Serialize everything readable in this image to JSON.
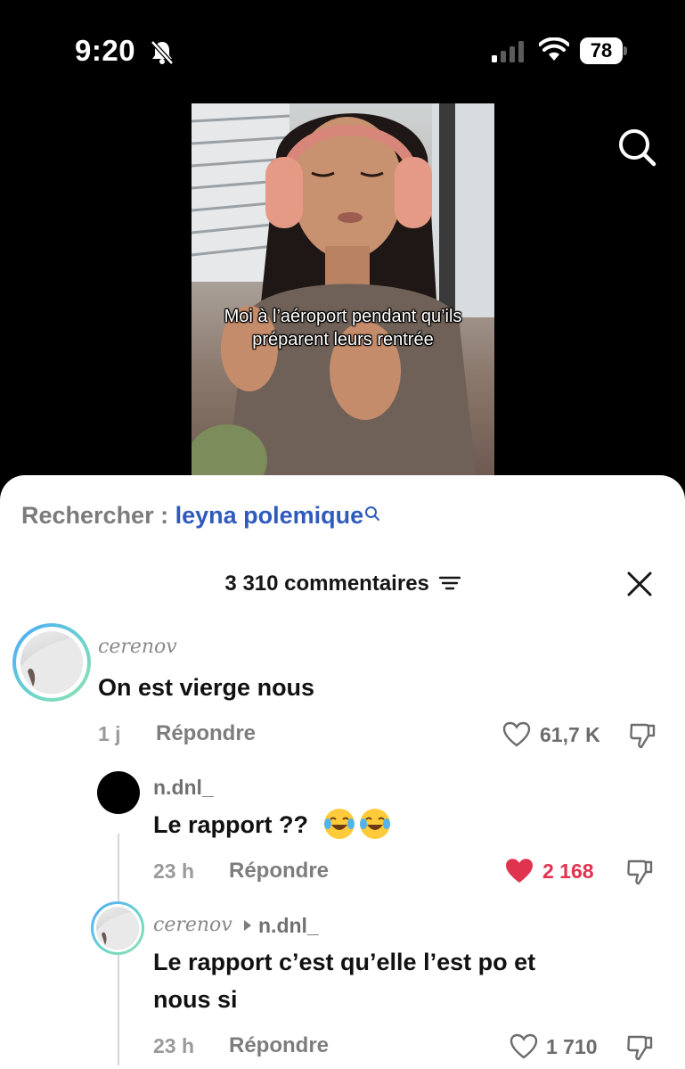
{
  "status_bar": {
    "time": "9:20",
    "battery": "78",
    "icons": [
      "bell-slash-icon",
      "cellular-signal-icon",
      "wifi-icon",
      "battery-icon"
    ]
  },
  "video": {
    "caption_line1": "Moi à l’aéroport pendant qu’ils",
    "caption_line2": "préparent leurs rentrée",
    "search_icon": "search-icon"
  },
  "search_suggestion": {
    "prefix": "Rechercher : ",
    "term": "leyna polemique",
    "icon": "search-icon"
  },
  "comments_header": {
    "count_label": "3 310 commentaires",
    "filter_icon": "filter-icon",
    "close_icon": "close-icon"
  },
  "comments": [
    {
      "username": "cerenov",
      "text": "On est vierge nous",
      "time": "1 j",
      "reply_label": "Répondre",
      "likes": "61,7 K",
      "liked": false
    },
    {
      "username": "n.dnl_",
      "text": "Le rapport ??",
      "emojis": [
        "face-with-tears-of-joy",
        "face-with-tears-of-joy"
      ],
      "time": "23 h",
      "reply_label": "Répondre",
      "likes": "2 168",
      "liked": true
    },
    {
      "username": "cerenov",
      "reply_to": "n.dnl_",
      "text_line1": "Le rapport c’est qu’elle l’est po et",
      "text_line2": "nous si",
      "time": "23 h",
      "reply_label": "Répondre",
      "likes": "1 710",
      "liked": false
    }
  ],
  "colors": {
    "accent_blue": "#2f5bbd",
    "like_red": "#e0334f",
    "avatar_ring": "#6fd6c8"
  }
}
